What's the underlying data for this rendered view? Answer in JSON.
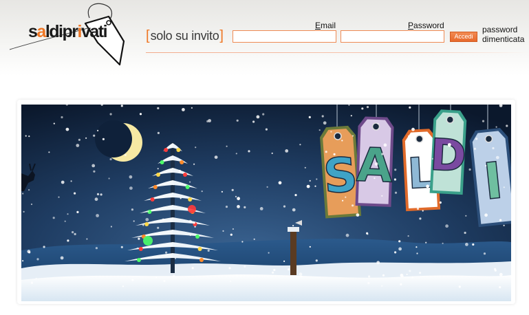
{
  "logo": {
    "prefix": "s",
    "accent_letter": "a",
    "rest_1": "ldipr",
    "accent_letter_2": "i",
    "rest_2": "vati"
  },
  "tagline": {
    "open_bracket": "[",
    "text": "solo su invito",
    "close_bracket": "]"
  },
  "login": {
    "email_label": "Email",
    "password_label": "Password",
    "email_value": "",
    "password_value": "",
    "submit_label": "Accedi",
    "forgot_line1": "password",
    "forgot_line2": "dimenticata"
  },
  "banner": {
    "tags": [
      "S",
      "A",
      "L",
      "D",
      "I"
    ]
  },
  "colors": {
    "accent": "#ef7623",
    "input_border": "#ef8a53",
    "banner_sky_top": "#0d1d33",
    "banner_sky_bottom": "#2c4f7a"
  },
  "icons": [
    "moon-icon",
    "christmas-tree-icon",
    "reindeer-icon",
    "mailbox-post-icon"
  ]
}
